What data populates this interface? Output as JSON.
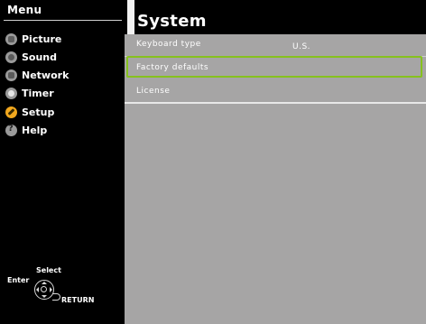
{
  "menu": {
    "title": "Menu",
    "items": [
      {
        "label": "Picture",
        "icon": "picture-icon"
      },
      {
        "label": "Sound",
        "icon": "sound-icon"
      },
      {
        "label": "Network",
        "icon": "network-icon"
      },
      {
        "label": "Timer",
        "icon": "timer-icon"
      },
      {
        "label": "Setup",
        "icon": "setup-icon"
      },
      {
        "label": "Help",
        "icon": "help-icon"
      }
    ],
    "active": "Setup"
  },
  "hints": {
    "select": "Select",
    "enter": "Enter",
    "return": "RETURN"
  },
  "panel": {
    "title": "System",
    "rows": [
      {
        "label": "Keyboard type",
        "value": "U.S."
      },
      {
        "label": "Factory defaults",
        "value": ""
      },
      {
        "label": "License",
        "value": ""
      }
    ],
    "selected": "Factory defaults"
  },
  "colors": {
    "highlight": "#86c11e",
    "panel_bg": "#a6a5a5",
    "active_icon": "#f2a81e"
  }
}
